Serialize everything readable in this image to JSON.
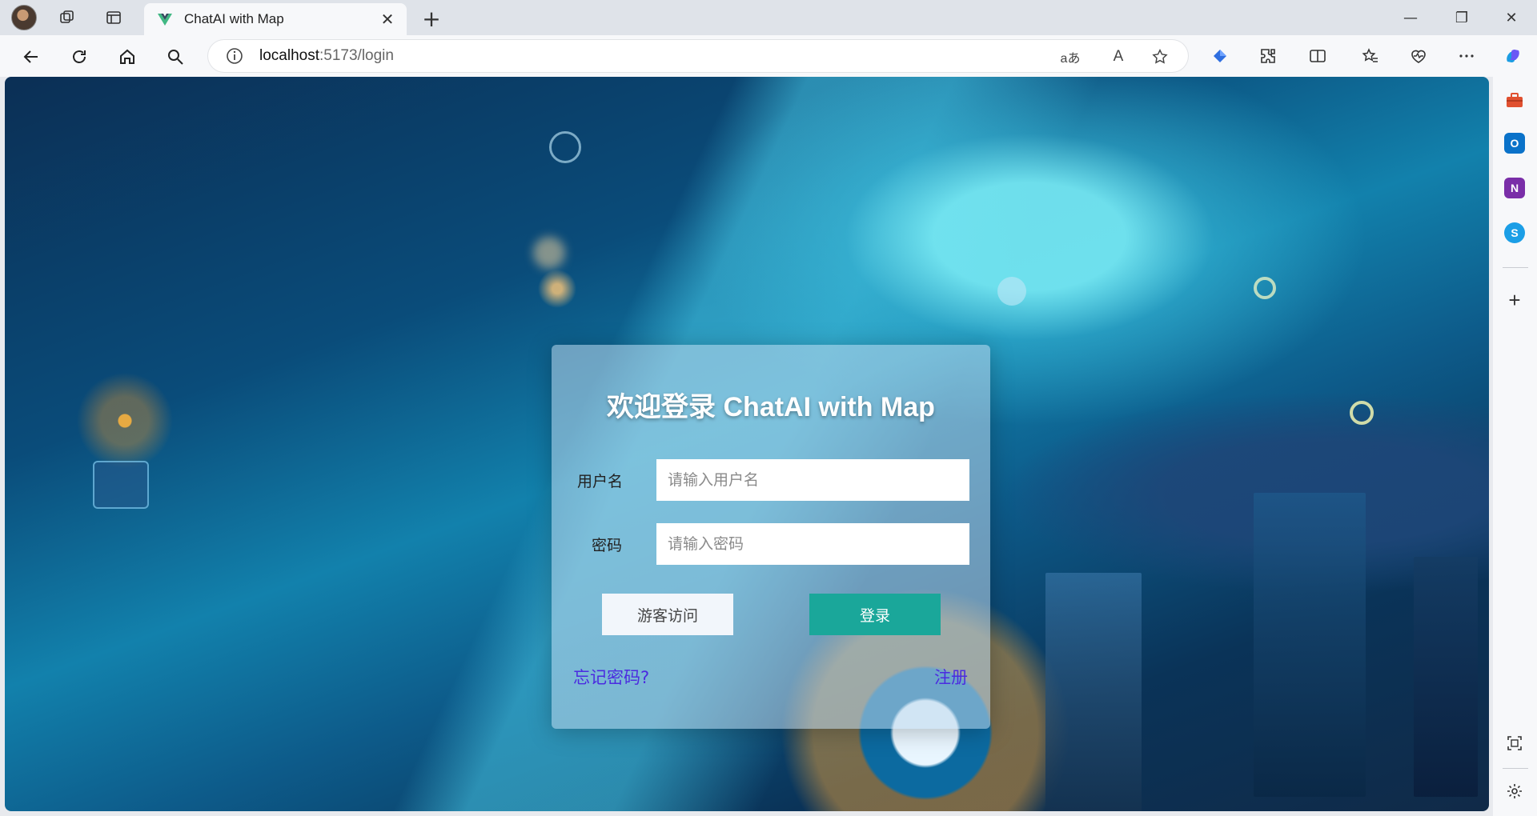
{
  "browser": {
    "tab": {
      "title": "ChatAI with Map",
      "close": "✕"
    },
    "new_tab": "+",
    "window": {
      "minimize": "—",
      "restore": "❐",
      "close": "✕"
    },
    "address": {
      "host": "localhost",
      "rest": ":5173/login"
    },
    "read_aloud": "A",
    "translate": "aあ"
  },
  "sidebar": {
    "outlook": "O",
    "onenote": "N",
    "skype": "S",
    "add": "+"
  },
  "login": {
    "title": "欢迎登录 ChatAI with Map",
    "username_label": "用户名",
    "username_placeholder": "请输入用户名",
    "password_label": "密码",
    "password_placeholder": "请输入密码",
    "guest_button": "游客访问",
    "login_button": "登录",
    "forgot_link": "忘记密码?",
    "register_link": "注册"
  },
  "colors": {
    "login_button": "#1aa79a",
    "link": "#4b2be0"
  }
}
